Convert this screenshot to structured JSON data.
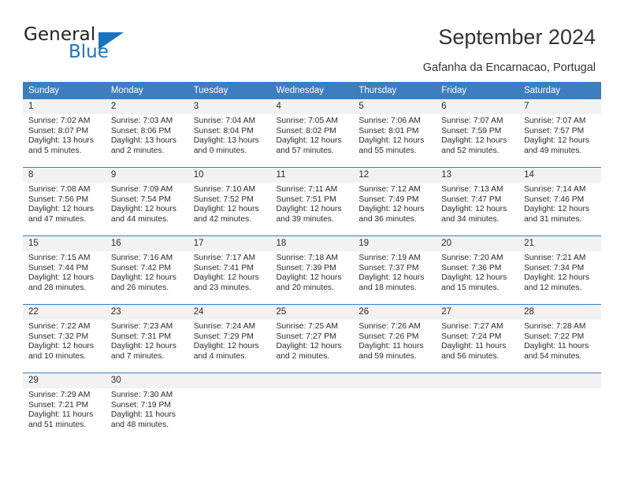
{
  "brand": {
    "name_top": "General",
    "name_bottom": "Blue",
    "triangle_icon": "triangle-icon",
    "accent_color": "#1b75bb"
  },
  "header": {
    "title": "September 2024",
    "subtitle": "Gafanha da Encarnacao, Portugal"
  },
  "theme": {
    "header_blue": "#3d7ebf",
    "daynum_band": "#f2f2f2",
    "text": "#2b2b2b"
  },
  "calendar": {
    "weekday_headers": [
      "Sunday",
      "Monday",
      "Tuesday",
      "Wednesday",
      "Thursday",
      "Friday",
      "Saturday"
    ],
    "labels": {
      "sunrise": "Sunrise:",
      "sunset": "Sunset:",
      "daylight": "Daylight:"
    },
    "weeks": [
      [
        {
          "day": "1",
          "sunrise": "Sunrise: 7:02 AM",
          "sunset": "Sunset: 8:07 PM",
          "daylight_line1": "Daylight: 13 hours",
          "daylight_line2": "and 5 minutes."
        },
        {
          "day": "2",
          "sunrise": "Sunrise: 7:03 AM",
          "sunset": "Sunset: 8:06 PM",
          "daylight_line1": "Daylight: 13 hours",
          "daylight_line2": "and 2 minutes."
        },
        {
          "day": "3",
          "sunrise": "Sunrise: 7:04 AM",
          "sunset": "Sunset: 8:04 PM",
          "daylight_line1": "Daylight: 13 hours",
          "daylight_line2": "and 0 minutes."
        },
        {
          "day": "4",
          "sunrise": "Sunrise: 7:05 AM",
          "sunset": "Sunset: 8:02 PM",
          "daylight_line1": "Daylight: 12 hours",
          "daylight_line2": "and 57 minutes."
        },
        {
          "day": "5",
          "sunrise": "Sunrise: 7:06 AM",
          "sunset": "Sunset: 8:01 PM",
          "daylight_line1": "Daylight: 12 hours",
          "daylight_line2": "and 55 minutes."
        },
        {
          "day": "6",
          "sunrise": "Sunrise: 7:07 AM",
          "sunset": "Sunset: 7:59 PM",
          "daylight_line1": "Daylight: 12 hours",
          "daylight_line2": "and 52 minutes."
        },
        {
          "day": "7",
          "sunrise": "Sunrise: 7:07 AM",
          "sunset": "Sunset: 7:57 PM",
          "daylight_line1": "Daylight: 12 hours",
          "daylight_line2": "and 49 minutes."
        }
      ],
      [
        {
          "day": "8",
          "sunrise": "Sunrise: 7:08 AM",
          "sunset": "Sunset: 7:56 PM",
          "daylight_line1": "Daylight: 12 hours",
          "daylight_line2": "and 47 minutes."
        },
        {
          "day": "9",
          "sunrise": "Sunrise: 7:09 AM",
          "sunset": "Sunset: 7:54 PM",
          "daylight_line1": "Daylight: 12 hours",
          "daylight_line2": "and 44 minutes."
        },
        {
          "day": "10",
          "sunrise": "Sunrise: 7:10 AM",
          "sunset": "Sunset: 7:52 PM",
          "daylight_line1": "Daylight: 12 hours",
          "daylight_line2": "and 42 minutes."
        },
        {
          "day": "11",
          "sunrise": "Sunrise: 7:11 AM",
          "sunset": "Sunset: 7:51 PM",
          "daylight_line1": "Daylight: 12 hours",
          "daylight_line2": "and 39 minutes."
        },
        {
          "day": "12",
          "sunrise": "Sunrise: 7:12 AM",
          "sunset": "Sunset: 7:49 PM",
          "daylight_line1": "Daylight: 12 hours",
          "daylight_line2": "and 36 minutes."
        },
        {
          "day": "13",
          "sunrise": "Sunrise: 7:13 AM",
          "sunset": "Sunset: 7:47 PM",
          "daylight_line1": "Daylight: 12 hours",
          "daylight_line2": "and 34 minutes."
        },
        {
          "day": "14",
          "sunrise": "Sunrise: 7:14 AM",
          "sunset": "Sunset: 7:46 PM",
          "daylight_line1": "Daylight: 12 hours",
          "daylight_line2": "and 31 minutes."
        }
      ],
      [
        {
          "day": "15",
          "sunrise": "Sunrise: 7:15 AM",
          "sunset": "Sunset: 7:44 PM",
          "daylight_line1": "Daylight: 12 hours",
          "daylight_line2": "and 28 minutes."
        },
        {
          "day": "16",
          "sunrise": "Sunrise: 7:16 AM",
          "sunset": "Sunset: 7:42 PM",
          "daylight_line1": "Daylight: 12 hours",
          "daylight_line2": "and 26 minutes."
        },
        {
          "day": "17",
          "sunrise": "Sunrise: 7:17 AM",
          "sunset": "Sunset: 7:41 PM",
          "daylight_line1": "Daylight: 12 hours",
          "daylight_line2": "and 23 minutes."
        },
        {
          "day": "18",
          "sunrise": "Sunrise: 7:18 AM",
          "sunset": "Sunset: 7:39 PM",
          "daylight_line1": "Daylight: 12 hours",
          "daylight_line2": "and 20 minutes."
        },
        {
          "day": "19",
          "sunrise": "Sunrise: 7:19 AM",
          "sunset": "Sunset: 7:37 PM",
          "daylight_line1": "Daylight: 12 hours",
          "daylight_line2": "and 18 minutes."
        },
        {
          "day": "20",
          "sunrise": "Sunrise: 7:20 AM",
          "sunset": "Sunset: 7:36 PM",
          "daylight_line1": "Daylight: 12 hours",
          "daylight_line2": "and 15 minutes."
        },
        {
          "day": "21",
          "sunrise": "Sunrise: 7:21 AM",
          "sunset": "Sunset: 7:34 PM",
          "daylight_line1": "Daylight: 12 hours",
          "daylight_line2": "and 12 minutes."
        }
      ],
      [
        {
          "day": "22",
          "sunrise": "Sunrise: 7:22 AM",
          "sunset": "Sunset: 7:32 PM",
          "daylight_line1": "Daylight: 12 hours",
          "daylight_line2": "and 10 minutes."
        },
        {
          "day": "23",
          "sunrise": "Sunrise: 7:23 AM",
          "sunset": "Sunset: 7:31 PM",
          "daylight_line1": "Daylight: 12 hours",
          "daylight_line2": "and 7 minutes."
        },
        {
          "day": "24",
          "sunrise": "Sunrise: 7:24 AM",
          "sunset": "Sunset: 7:29 PM",
          "daylight_line1": "Daylight: 12 hours",
          "daylight_line2": "and 4 minutes."
        },
        {
          "day": "25",
          "sunrise": "Sunrise: 7:25 AM",
          "sunset": "Sunset: 7:27 PM",
          "daylight_line1": "Daylight: 12 hours",
          "daylight_line2": "and 2 minutes."
        },
        {
          "day": "26",
          "sunrise": "Sunrise: 7:26 AM",
          "sunset": "Sunset: 7:26 PM",
          "daylight_line1": "Daylight: 11 hours",
          "daylight_line2": "and 59 minutes."
        },
        {
          "day": "27",
          "sunrise": "Sunrise: 7:27 AM",
          "sunset": "Sunset: 7:24 PM",
          "daylight_line1": "Daylight: 11 hours",
          "daylight_line2": "and 56 minutes."
        },
        {
          "day": "28",
          "sunrise": "Sunrise: 7:28 AM",
          "sunset": "Sunset: 7:22 PM",
          "daylight_line1": "Daylight: 11 hours",
          "daylight_line2": "and 54 minutes."
        }
      ],
      [
        {
          "day": "29",
          "sunrise": "Sunrise: 7:29 AM",
          "sunset": "Sunset: 7:21 PM",
          "daylight_line1": "Daylight: 11 hours",
          "daylight_line2": "and 51 minutes."
        },
        {
          "day": "30",
          "sunrise": "Sunrise: 7:30 AM",
          "sunset": "Sunset: 7:19 PM",
          "daylight_line1": "Daylight: 11 hours",
          "daylight_line2": "and 48 minutes."
        },
        {
          "day": "",
          "sunrise": "",
          "sunset": "",
          "daylight_line1": "",
          "daylight_line2": ""
        },
        {
          "day": "",
          "sunrise": "",
          "sunset": "",
          "daylight_line1": "",
          "daylight_line2": ""
        },
        {
          "day": "",
          "sunrise": "",
          "sunset": "",
          "daylight_line1": "",
          "daylight_line2": ""
        },
        {
          "day": "",
          "sunrise": "",
          "sunset": "",
          "daylight_line1": "",
          "daylight_line2": ""
        },
        {
          "day": "",
          "sunrise": "",
          "sunset": "",
          "daylight_line1": "",
          "daylight_line2": ""
        }
      ]
    ]
  }
}
